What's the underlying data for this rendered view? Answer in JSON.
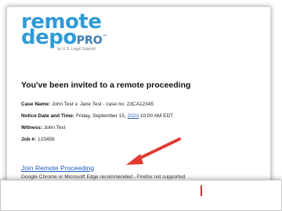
{
  "logo": {
    "word1": "remote",
    "word2": "depo",
    "word2_suffix": "PRO",
    "trademark": "™",
    "tagline": "by U.S. Legal Support"
  },
  "email": {
    "heading": "You've been invited to a remote proceeding",
    "case_label": "Case Name:",
    "case_value": " John Test v. Jane Test - case no. 23CA12345",
    "notice_label": "Notice Date and Time:",
    "notice_value_before": " Friday, September 15, ",
    "notice_year": "2023",
    "notice_value_after": " 10:00 AM EDT",
    "witness_label": "Witness:",
    "witness_value": " John Test",
    "job_label": "Job #:",
    "job_value": " 123456",
    "join_link": "Join Remote Proceeding",
    "browser_note": "Google Chrome or Microsoft Edge recommended - Firefox not supported"
  },
  "colors": {
    "brand": "#2f9bd6",
    "link": "#1a5fc9",
    "arrow": "#e03a2f"
  }
}
